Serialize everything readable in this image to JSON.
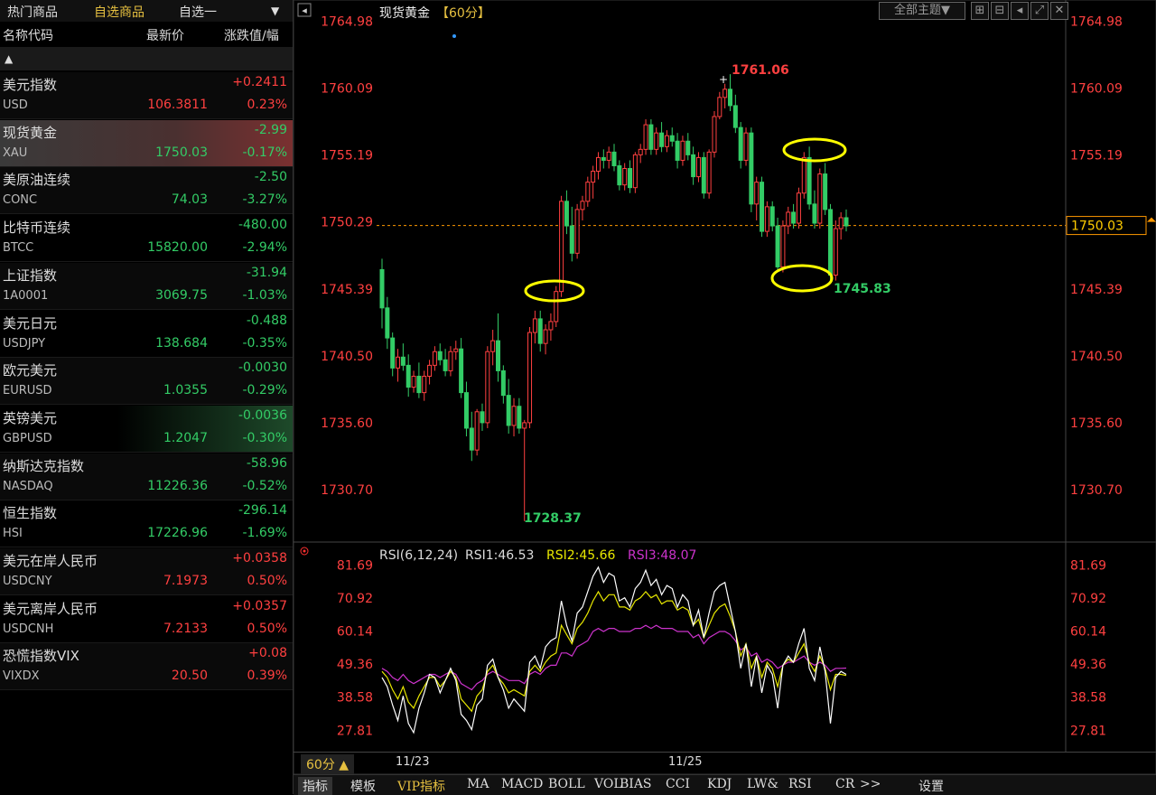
{
  "left_tabs": [
    "热门商品",
    "自选商品",
    "自选一"
  ],
  "left_tab_dropdown": "▼",
  "columns": {
    "name": "名称代码",
    "price": "最新价",
    "change": "涨跌值/幅"
  },
  "sort_glyph": "▲",
  "watchlist": [
    {
      "name": "美元指数",
      "code": "USD",
      "price": "106.3811",
      "change": "+0.2411",
      "pct": "0.23%",
      "dir": "up"
    },
    {
      "name": "现货黄金",
      "code": "XAU",
      "price": "1750.03",
      "change": "-2.99",
      "pct": "-0.17%",
      "dir": "dn",
      "selected": true
    },
    {
      "name": "美原油连续",
      "code": "CONC",
      "price": "74.03",
      "change": "-2.50",
      "pct": "-3.27%",
      "dir": "dn"
    },
    {
      "name": "比特币连续",
      "code": "BTCC",
      "price": "15820.00",
      "change": "-480.00",
      "pct": "-2.94%",
      "dir": "dn"
    },
    {
      "name": "上证指数",
      "code": "1A0001",
      "price": "3069.75",
      "change": "-31.94",
      "pct": "-1.03%",
      "dir": "dn"
    },
    {
      "name": "美元日元",
      "code": "USDJPY",
      "price": "138.684",
      "change": "-0.488",
      "pct": "-0.35%",
      "dir": "dn"
    },
    {
      "name": "欧元美元",
      "code": "EURUSD",
      "price": "1.0355",
      "change": "-0.0030",
      "pct": "-0.29%",
      "dir": "dn"
    },
    {
      "name": "英镑美元",
      "code": "GBPUSD",
      "price": "1.2047",
      "change": "-0.0036",
      "pct": "-0.30%",
      "dir": "dn",
      "highlight": true
    },
    {
      "name": "纳斯达克指数",
      "code": "NASDAQ",
      "price": "11226.36",
      "change": "-58.96",
      "pct": "-0.52%",
      "dir": "dn"
    },
    {
      "name": "恒生指数",
      "code": "HSI",
      "price": "17226.96",
      "change": "-296.14",
      "pct": "-1.69%",
      "dir": "dn"
    },
    {
      "name": "美元在岸人民币",
      "code": "USDCNY",
      "price": "7.1973",
      "change": "+0.0358",
      "pct": "0.50%",
      "dir": "up"
    },
    {
      "name": "美元离岸人民币",
      "code": "USDCNH",
      "price": "7.2133",
      "change": "+0.0357",
      "pct": "0.50%",
      "dir": "up"
    },
    {
      "name": "恐慌指数VIX",
      "code": "VIXDX",
      "price": "20.50",
      "change": "+0.08",
      "pct": "0.39%",
      "dir": "up"
    }
  ],
  "chart_title": "现货黄金",
  "chart_period": "【60分】",
  "theme_button": "全部主题▼",
  "price_axis": [
    "1764.98",
    "1760.09",
    "1755.19",
    "1750.29",
    "1745.39",
    "1740.50",
    "1735.60",
    "1730.70"
  ],
  "current_price": "1750.03",
  "annotations": {
    "high": "1761.06",
    "low": "1728.37",
    "recent_low": "1745.83"
  },
  "rsi_header": {
    "label": "RSI(6,12,24)",
    "rsi1": "RSI1:46.53",
    "rsi2": "RSI2:45.66",
    "rsi3": "RSI3:48.07"
  },
  "rsi_axis": [
    "81.69",
    "70.92",
    "60.14",
    "49.36",
    "38.58",
    "27.81"
  ],
  "date_labels": [
    "11/23",
    "11/25"
  ],
  "period_button": "60分 ▲",
  "bottom_tabs": [
    "指标",
    "模板",
    "VIP指标",
    "MA",
    "MACD",
    "BOLL",
    "VOL",
    "BIAS",
    "CCI",
    "KDJ",
    "LW&",
    "RSI",
    "CR",
    ">>",
    "设置"
  ],
  "colors": {
    "up": "#ff4040",
    "down": "#33cc66",
    "rsi1": "#ffffff",
    "rsi2": "#e8e800",
    "rsi3": "#cc33cc",
    "marker": "#ffff00",
    "price_line": "#ff9900"
  },
  "chart_data": {
    "type": "candlestick",
    "title": "现货黄金【60分】",
    "ylim": [
      1727.0,
      1766.0
    ],
    "candles": [
      [
        1746.8,
        1747.6,
        1742.5,
        1744.0
      ],
      [
        1744.0,
        1744.8,
        1741.0,
        1741.8
      ],
      [
        1741.8,
        1742.2,
        1739.0,
        1739.6
      ],
      [
        1739.6,
        1741.0,
        1738.6,
        1740.4
      ],
      [
        1740.4,
        1741.4,
        1739.4,
        1739.8
      ],
      [
        1739.8,
        1740.6,
        1737.5,
        1738.2
      ],
      [
        1738.2,
        1739.4,
        1737.8,
        1739.0
      ],
      [
        1739.0,
        1740.0,
        1737.4,
        1737.8
      ],
      [
        1737.8,
        1739.4,
        1737.2,
        1739.0
      ],
      [
        1739.0,
        1740.2,
        1738.4,
        1739.8
      ],
      [
        1739.8,
        1741.2,
        1739.4,
        1740.8
      ],
      [
        1740.8,
        1741.4,
        1739.8,
        1740.2
      ],
      [
        1740.2,
        1741.0,
        1739.0,
        1739.4
      ],
      [
        1739.4,
        1741.2,
        1739.0,
        1740.8
      ],
      [
        1740.8,
        1741.6,
        1740.2,
        1741.0
      ],
      [
        1741.0,
        1741.8,
        1737.4,
        1737.8
      ],
      [
        1737.8,
        1738.6,
        1734.6,
        1735.2
      ],
      [
        1735.2,
        1736.4,
        1732.8,
        1733.6
      ],
      [
        1733.6,
        1736.6,
        1733.2,
        1736.4
      ],
      [
        1736.4,
        1737.0,
        1735.0,
        1735.6
      ],
      [
        1735.6,
        1741.2,
        1735.2,
        1740.8
      ],
      [
        1740.8,
        1742.4,
        1739.8,
        1741.6
      ],
      [
        1741.6,
        1743.6,
        1738.6,
        1739.4
      ],
      [
        1739.4,
        1739.8,
        1737.0,
        1737.6
      ],
      [
        1737.6,
        1738.8,
        1734.8,
        1735.4
      ],
      [
        1735.4,
        1737.4,
        1734.6,
        1736.8
      ],
      [
        1736.8,
        1737.4,
        1734.8,
        1735.2
      ],
      [
        1735.2,
        1735.8,
        1728.4,
        1735.6
      ],
      [
        1735.6,
        1742.6,
        1735.2,
        1742.2
      ],
      [
        1742.2,
        1743.8,
        1741.4,
        1743.2
      ],
      [
        1743.2,
        1743.8,
        1740.8,
        1741.4
      ],
      [
        1741.4,
        1742.8,
        1740.6,
        1742.4
      ],
      [
        1742.4,
        1743.6,
        1741.6,
        1743.0
      ],
      [
        1743.0,
        1745.6,
        1742.6,
        1745.2
      ],
      [
        1745.2,
        1752.2,
        1744.8,
        1751.8
      ],
      [
        1751.8,
        1752.6,
        1749.4,
        1750.0
      ],
      [
        1750.0,
        1751.4,
        1747.4,
        1748.0
      ],
      [
        1748.0,
        1751.6,
        1747.6,
        1751.2
      ],
      [
        1751.2,
        1752.2,
        1750.4,
        1751.8
      ],
      [
        1751.8,
        1753.6,
        1751.4,
        1753.2
      ],
      [
        1753.2,
        1754.4,
        1752.0,
        1754.0
      ],
      [
        1754.0,
        1755.4,
        1753.4,
        1755.0
      ],
      [
        1755.0,
        1755.6,
        1754.2,
        1754.8
      ],
      [
        1754.8,
        1755.8,
        1754.2,
        1755.4
      ],
      [
        1755.4,
        1756.0,
        1754.0,
        1754.4
      ],
      [
        1754.4,
        1754.8,
        1752.6,
        1753.0
      ],
      [
        1753.0,
        1754.6,
        1752.6,
        1754.2
      ],
      [
        1754.2,
        1754.8,
        1752.4,
        1752.8
      ],
      [
        1752.8,
        1755.4,
        1752.4,
        1755.2
      ],
      [
        1755.2,
        1756.0,
        1754.6,
        1755.6
      ],
      [
        1755.6,
        1757.8,
        1755.2,
        1757.4
      ],
      [
        1757.4,
        1757.8,
        1755.2,
        1755.6
      ],
      [
        1755.6,
        1757.2,
        1755.2,
        1756.8
      ],
      [
        1756.8,
        1757.6,
        1755.4,
        1755.8
      ],
      [
        1755.8,
        1757.0,
        1755.4,
        1756.6
      ],
      [
        1756.6,
        1757.2,
        1755.8,
        1756.2
      ],
      [
        1756.2,
        1756.8,
        1754.2,
        1754.8
      ],
      [
        1754.8,
        1756.6,
        1754.4,
        1756.2
      ],
      [
        1756.2,
        1756.8,
        1754.8,
        1755.2
      ],
      [
        1755.2,
        1755.8,
        1753.0,
        1753.6
      ],
      [
        1753.6,
        1755.4,
        1753.2,
        1755.0
      ],
      [
        1755.0,
        1755.4,
        1752.0,
        1752.4
      ],
      [
        1752.4,
        1755.6,
        1752.0,
        1755.4
      ],
      [
        1755.4,
        1758.4,
        1755.0,
        1758.0
      ],
      [
        1758.0,
        1759.8,
        1757.8,
        1759.4
      ],
      [
        1759.4,
        1760.4,
        1758.6,
        1760.0
      ],
      [
        1760.0,
        1761.1,
        1758.4,
        1758.8
      ],
      [
        1758.8,
        1759.6,
        1756.8,
        1757.2
      ],
      [
        1757.2,
        1757.6,
        1754.2,
        1754.8
      ],
      [
        1754.8,
        1757.2,
        1754.4,
        1756.8
      ],
      [
        1756.8,
        1757.2,
        1751.0,
        1751.6
      ],
      [
        1751.6,
        1753.6,
        1750.4,
        1753.2
      ],
      [
        1753.2,
        1753.6,
        1749.2,
        1749.6
      ],
      [
        1749.6,
        1751.8,
        1749.2,
        1751.4
      ],
      [
        1751.4,
        1751.8,
        1749.6,
        1750.0
      ],
      [
        1750.0,
        1750.6,
        1746.6,
        1747.0
      ],
      [
        1747.0,
        1750.4,
        1746.6,
        1750.0
      ],
      [
        1750.0,
        1751.4,
        1749.4,
        1751.0
      ],
      [
        1751.0,
        1751.6,
        1749.8,
        1750.2
      ],
      [
        1750.2,
        1752.8,
        1749.8,
        1752.4
      ],
      [
        1752.4,
        1755.4,
        1752.0,
        1755.0
      ],
      [
        1755.0,
        1755.8,
        1751.2,
        1751.6
      ],
      [
        1751.6,
        1752.6,
        1749.8,
        1750.2
      ],
      [
        1750.2,
        1754.2,
        1749.8,
        1753.8
      ],
      [
        1753.8,
        1754.6,
        1750.8,
        1751.2
      ],
      [
        1751.2,
        1751.6,
        1745.8,
        1746.4
      ],
      [
        1746.4,
        1750.4,
        1746.0,
        1749.8
      ],
      [
        1749.8,
        1751.0,
        1749.0,
        1750.6
      ],
      [
        1750.6,
        1751.2,
        1749.6,
        1750.0
      ]
    ],
    "rsi1": [
      45,
      42,
      36,
      31,
      39,
      30,
      27,
      35,
      40,
      46,
      45,
      40,
      44,
      48,
      44,
      33,
      31,
      28,
      36,
      38,
      49,
      51,
      45,
      41,
      35,
      38,
      36,
      34,
      50,
      52,
      48,
      55,
      57,
      58,
      70,
      62,
      57,
      66,
      68,
      73,
      78,
      81,
      76,
      79,
      78,
      70,
      71,
      68,
      74,
      76,
      80,
      75,
      77,
      72,
      75,
      74,
      68,
      72,
      70,
      62,
      67,
      58,
      66,
      73,
      75,
      76,
      68,
      60,
      48,
      56,
      42,
      52,
      40,
      49,
      46,
      35,
      49,
      52,
      50,
      56,
      61,
      48,
      44,
      55,
      47,
      30,
      45,
      47,
      46
    ],
    "rsi2": [
      47,
      45,
      41,
      38,
      42,
      37,
      35,
      39,
      42,
      45,
      45,
      42,
      44,
      47,
      45,
      38,
      36,
      34,
      39,
      41,
      47,
      49,
      45,
      43,
      40,
      41,
      40,
      39,
      47,
      49,
      47,
      50,
      52,
      53,
      62,
      59,
      56,
      61,
      63,
      66,
      70,
      73,
      70,
      72,
      72,
      68,
      68,
      67,
      70,
      71,
      73,
      71,
      72,
      69,
      70,
      70,
      67,
      68,
      67,
      62,
      64,
      58,
      62,
      66,
      68,
      69,
      65,
      60,
      52,
      56,
      48,
      52,
      45,
      50,
      48,
      42,
      49,
      51,
      50,
      53,
      56,
      50,
      47,
      52,
      48,
      41,
      46,
      46,
      45.66
    ],
    "rsi3": [
      48,
      47,
      45,
      44,
      46,
      44,
      43,
      44,
      45,
      46,
      46,
      45,
      46,
      47,
      46,
      43,
      42,
      41,
      43,
      44,
      46,
      47,
      46,
      45,
      44,
      44,
      44,
      43,
      46,
      47,
      46,
      48,
      49,
      49,
      53,
      53,
      52,
      55,
      56,
      57,
      60,
      61,
      60,
      61,
      61,
      60,
      60,
      60,
      61,
      61,
      62,
      61,
      62,
      61,
      61,
      61,
      60,
      60,
      60,
      58,
      59,
      56,
      58,
      59,
      60,
      60,
      59,
      57,
      54,
      55,
      52,
      53,
      50,
      51,
      50,
      48,
      49,
      50,
      50,
      51,
      52,
      50,
      49,
      50,
      49,
      47,
      48,
      48,
      48.07
    ]
  }
}
